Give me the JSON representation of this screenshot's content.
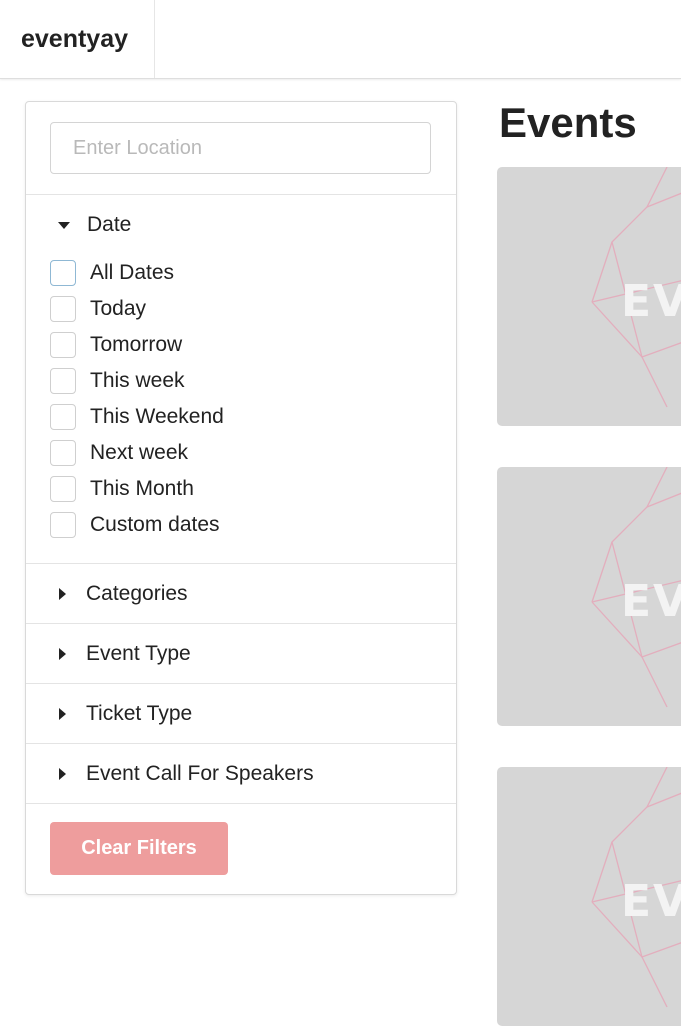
{
  "header": {
    "brand": "eventyay"
  },
  "filters": {
    "location_placeholder": "Enter Location",
    "location_value": "",
    "date_section": {
      "title": "Date",
      "expanded": true,
      "options": [
        {
          "label": "All Dates",
          "checked": false
        },
        {
          "label": "Today",
          "checked": false
        },
        {
          "label": "Tomorrow",
          "checked": false
        },
        {
          "label": "This week",
          "checked": false
        },
        {
          "label": "This Weekend",
          "checked": false
        },
        {
          "label": "Next week",
          "checked": false
        },
        {
          "label": "This Month",
          "checked": false
        },
        {
          "label": "Custom dates",
          "checked": false
        }
      ]
    },
    "sections": [
      {
        "title": "Categories",
        "expanded": false
      },
      {
        "title": "Event Type",
        "expanded": false
      },
      {
        "title": "Ticket Type",
        "expanded": false
      },
      {
        "title": "Event Call For Speakers",
        "expanded": false
      }
    ],
    "clear_label": "Clear Filters"
  },
  "main": {
    "title": "Events",
    "cards": [
      {
        "placeholder_text": "EVI"
      },
      {
        "placeholder_text": "EVI"
      },
      {
        "placeholder_text": "EVI"
      }
    ]
  },
  "colors": {
    "accent_button": "#ee9d9d",
    "card_placeholder": "#d6d6d6",
    "card_lines": "#e3aebd"
  }
}
